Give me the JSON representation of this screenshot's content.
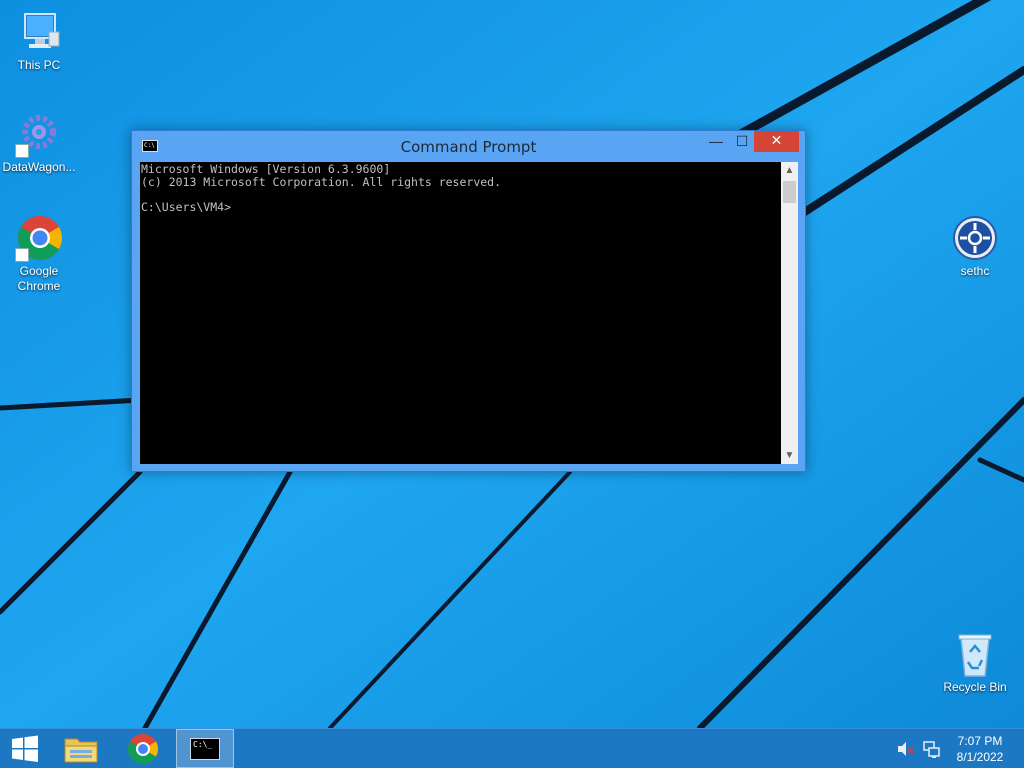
{
  "desktop": {
    "icons": [
      {
        "label": "This PC",
        "icon": "this-pc-icon"
      },
      {
        "label": "DataWagon...",
        "icon": "datawagon-icon"
      },
      {
        "label": "Google\nChrome",
        "icon": "chrome-icon"
      },
      {
        "label": "sethc",
        "icon": "sethc-icon"
      },
      {
        "label": "Recycle Bin",
        "icon": "recycle-bin-icon"
      }
    ]
  },
  "cmd_window": {
    "title": "Command Prompt",
    "title_icon_text": "C:\\",
    "minimize_symbol": "—",
    "maximize_symbol": "☐",
    "close_symbol": "✕",
    "console_text": "Microsoft Windows [Version 6.3.9600]\n(c) 2013 Microsoft Corporation. All rights reserved.\n\nC:\\Users\\VM4>",
    "scroll_up_symbol": "▲",
    "scroll_down_symbol": "▼"
  },
  "taskbar": {
    "cmd_icon_text": "C:\\_",
    "clock": {
      "time": "7:07 PM",
      "date": "8/1/2022"
    }
  },
  "colors": {
    "desktop_bg": "#1aa0ec",
    "window_frame": "#5aa4f4",
    "close_button": "#d44538",
    "taskbar": "#1d78c4"
  }
}
